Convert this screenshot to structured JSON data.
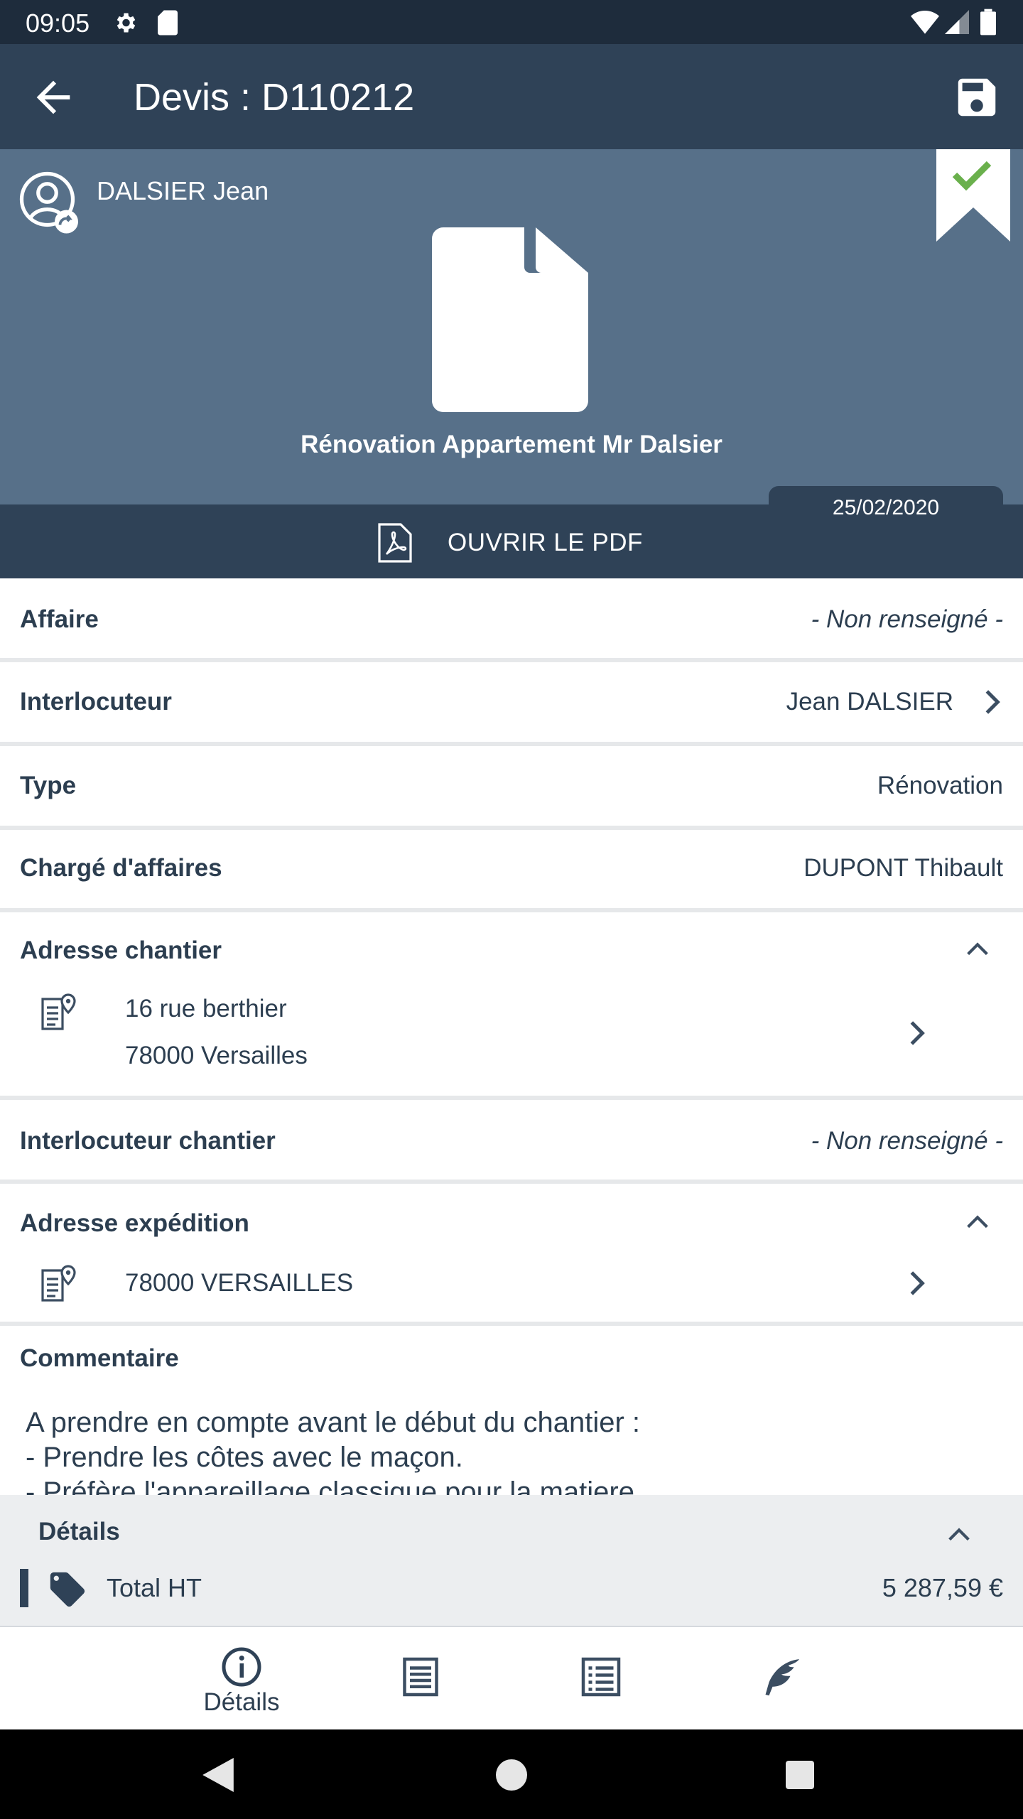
{
  "status_bar": {
    "time": "09:05"
  },
  "app_bar": {
    "title": "Devis : D110212"
  },
  "header": {
    "client_name": "DALSIER Jean",
    "project_title": "Rénovation Appartement Mr Dalsier",
    "date": "25/02/2020",
    "pdf_label": "OUVRIR LE PDF"
  },
  "fields": {
    "affaire": {
      "label": "Affaire",
      "value": "- Non renseigné -"
    },
    "interlocuteur": {
      "label": "Interlocuteur",
      "value": "Jean DALSIER"
    },
    "type": {
      "label": "Type",
      "value": "Rénovation"
    },
    "charge": {
      "label": "Chargé d'affaires",
      "value": "DUPONT Thibault"
    },
    "adresse_chantier": {
      "label": "Adresse chantier",
      "line1": "16 rue berthier",
      "line2": "78000 Versailles"
    },
    "interlocuteur_chantier": {
      "label": "Interlocuteur chantier",
      "value": "- Non renseigné -"
    },
    "adresse_expedition": {
      "label": "Adresse expédition",
      "line1": "78000 VERSAILLES"
    }
  },
  "comment": {
    "label": "Commentaire",
    "text": "A prendre en compte avant le début du chantier :\n- Prendre les côtes avec le maçon.\n- Préfère l'appareillage classique pour la matiere"
  },
  "details": {
    "title": "Détails",
    "total_label": "Total HT",
    "total_value": "5 287,59 €"
  },
  "bottom_nav": {
    "details_label": "Détails"
  },
  "colors": {
    "primary_dark": "#2f4257",
    "header_bg": "#577089",
    "status_bg": "#1e2c3c",
    "accent_green": "#6ab04c",
    "text": "#2c3e50"
  }
}
